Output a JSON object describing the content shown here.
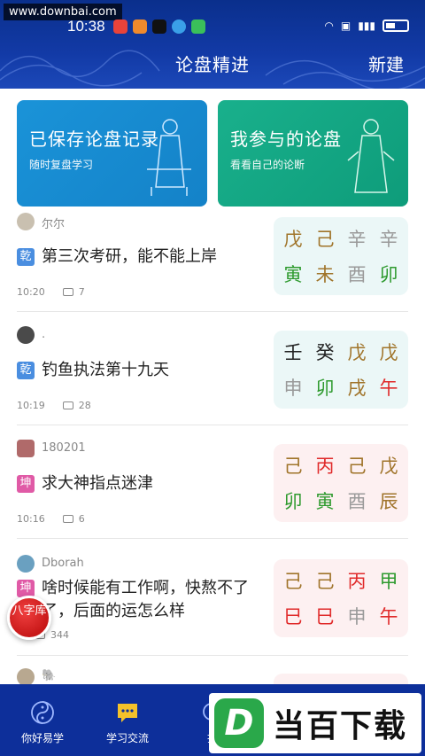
{
  "watermark_top": "www.downbai.com",
  "status": {
    "time": "10:38"
  },
  "header": {
    "title": "论盘精进",
    "new_label": "新建"
  },
  "banners": [
    {
      "title": "已保存论盘记录",
      "subtitle": "随时复盘学习"
    },
    {
      "title": "我参与的论盘",
      "subtitle": "看看自己的论断"
    }
  ],
  "posts": [
    {
      "user": "尔尔",
      "tag": "乾",
      "title": "第三次考研，能不能上岸",
      "time": "10:20",
      "comments": "7",
      "stems": [
        "戊",
        "己",
        "辛",
        "辛"
      ],
      "branches": [
        "寅",
        "未",
        "酉",
        "卯"
      ]
    },
    {
      "user": ".",
      "tag": "乾",
      "title": "钓鱼执法第十九天",
      "time": "10:19",
      "comments": "28",
      "stems": [
        "壬",
        "癸",
        "戊",
        "戊"
      ],
      "branches": [
        "申",
        "卯",
        "戌",
        "午"
      ]
    },
    {
      "user": "180201",
      "tag": "坤",
      "title": "求大神指点迷津",
      "time": "10:16",
      "comments": "6",
      "stems": [
        "己",
        "丙",
        "己",
        "戊"
      ],
      "branches": [
        "卯",
        "寅",
        "酉",
        "辰"
      ]
    },
    {
      "user": "Dborah",
      "tag": "坤",
      "title": "啥时候能有工作啊，快熬不了了，后面的运怎么样",
      "time": "",
      "comments": "344",
      "stems": [
        "己",
        "己",
        "丙",
        "甲"
      ],
      "branches": [
        "巳",
        "巳",
        "申",
        "午"
      ]
    },
    {
      "user": "🐘"
    }
  ],
  "float_badge": "八字库",
  "nav": [
    {
      "label": "你好易学",
      "icon": "yin-yang-icon"
    },
    {
      "label": "学习交流",
      "icon": "chat-icon"
    },
    {
      "label": "找",
      "icon": "search-icon"
    }
  ],
  "watermark_logo": {
    "letter": "D",
    "text": "当百下载"
  }
}
